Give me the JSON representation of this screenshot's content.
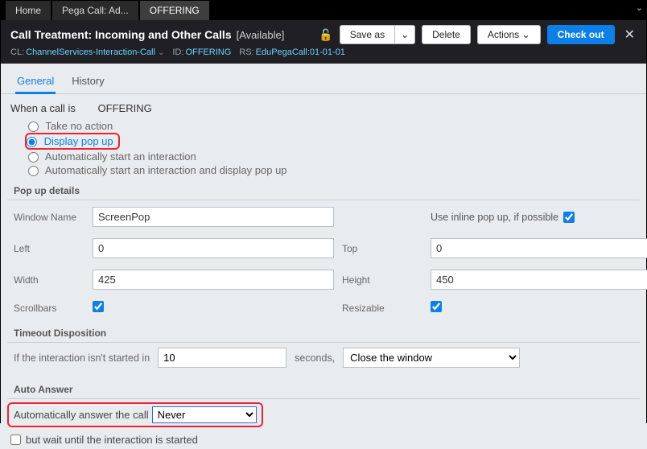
{
  "tabs": {
    "items": [
      "Home",
      "Pega Call: Ad...",
      "OFFERING"
    ],
    "active_index": 2
  },
  "header": {
    "title": "Call Treatment: Incoming and Other Calls",
    "availability": "[Available]",
    "meta": {
      "cl_label": "CL:",
      "cl_value": "ChannelServices-Interaction-Call",
      "id_label": "ID:",
      "id_value": "OFFERING",
      "rs_label": "RS:",
      "rs_value": "EduPegaCall:01-01-01"
    },
    "buttons": {
      "save_as": "Save as",
      "delete": "Delete",
      "actions": "Actions",
      "check_out": "Check out"
    }
  },
  "subtabs": {
    "general": "General",
    "history": "History"
  },
  "when_call": {
    "label": "When a call is",
    "value": "OFFERING",
    "options": {
      "take_no_action": "Take no action",
      "display_pop_up": "Display pop up",
      "auto_start": "Automatically start an interaction",
      "auto_start_popup": "Automatically start an interaction and display pop up"
    },
    "selected": "display_pop_up"
  },
  "popup": {
    "section_title": "Pop up details",
    "labels": {
      "window_name": "Window Name",
      "use_inline": "Use inline pop up, if possible",
      "left": "Left",
      "top": "Top",
      "width": "Width",
      "height": "Height",
      "scrollbars": "Scrollbars",
      "resizable": "Resizable"
    },
    "values": {
      "window_name": "ScreenPop",
      "use_inline": true,
      "left": "0",
      "top": "0",
      "width": "425",
      "height": "450",
      "scrollbars": true,
      "resizable": true
    }
  },
  "timeout": {
    "section_title": "Timeout Disposition",
    "label_before": "If the interaction isn't started in",
    "seconds_value": "10",
    "label_after": "seconds,",
    "action_value": "Close the window"
  },
  "auto_answer": {
    "section_title": "Auto Answer",
    "label": "Automatically answer the call",
    "value": "Never",
    "wait_label": "but wait until the interaction is started",
    "wait_checked": false
  }
}
